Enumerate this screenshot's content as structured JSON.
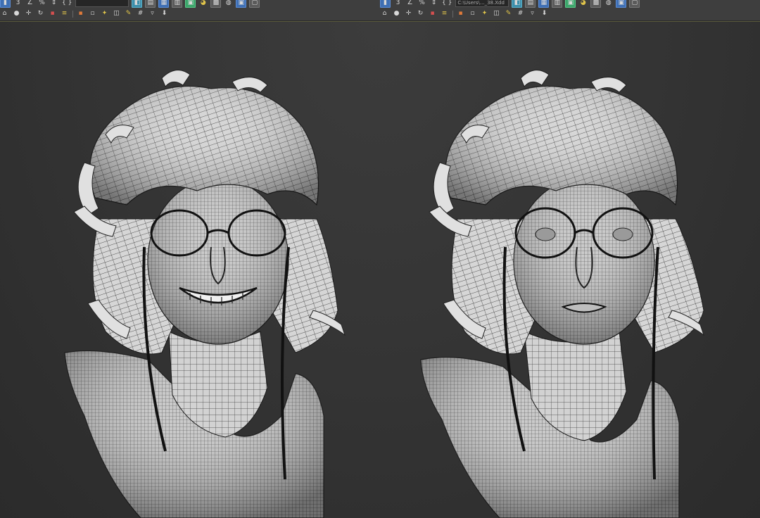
{
  "toolbar": {
    "left": {
      "snap_label": "3",
      "percent_snap": "%",
      "braces": "{ }",
      "field_text": ""
    },
    "right": {
      "snap_label": "3",
      "percent_snap": "%",
      "braces": "{ }",
      "field_text": "C:\\Users\\..._38.Xdd"
    }
  },
  "viewport": {
    "left_model": {
      "expression": "smiling"
    },
    "right_model": {
      "expression": "neutral"
    }
  },
  "colors": {
    "background": "#3a3a3a",
    "mesh": "#cfcfcf",
    "wire": "#1a1a1a",
    "toolbar_accent": "#5a5a3c"
  }
}
